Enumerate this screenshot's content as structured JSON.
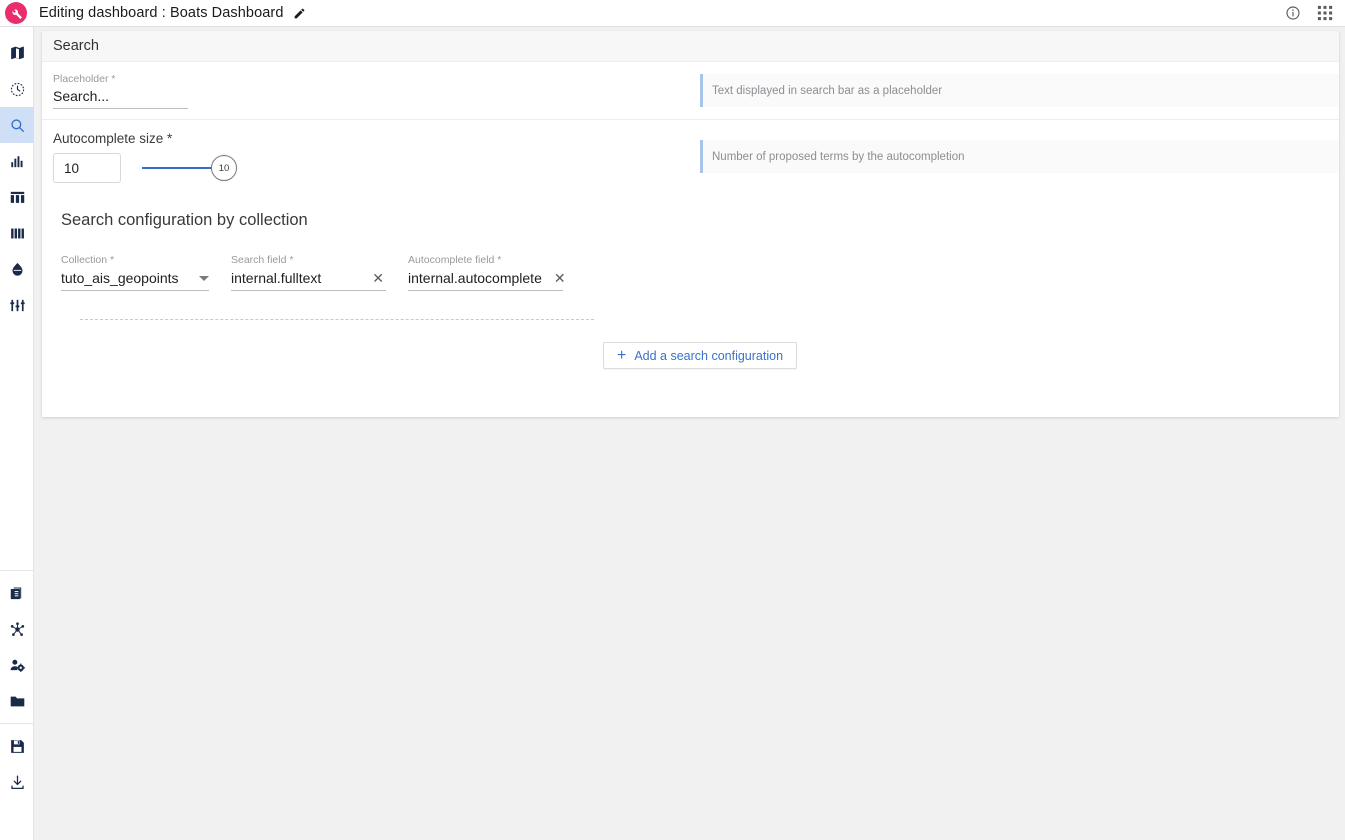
{
  "topbar": {
    "logo_icon": "wrench-icon",
    "logo_color": "#ea2d6f",
    "title": "Editing dashboard : Boats Dashboard",
    "edit_icon": "pencil-icon",
    "info_icon": "info-circle-icon",
    "apps_icon": "apps-grid-icon"
  },
  "sidebar": {
    "items": [
      {
        "name": "map",
        "icon": "map-icon",
        "active": false
      },
      {
        "name": "timeline",
        "icon": "clock-dashed-icon",
        "active": false
      },
      {
        "name": "search",
        "icon": "search-icon",
        "active": true
      },
      {
        "name": "histogram",
        "icon": "bar-chart-icon",
        "active": false
      },
      {
        "name": "table",
        "icon": "table-icon",
        "active": false
      },
      {
        "name": "columns",
        "icon": "columns-icon",
        "active": false
      },
      {
        "name": "donut",
        "icon": "drop-icon",
        "active": false
      },
      {
        "name": "filters",
        "icon": "sliders-icon",
        "active": false
      },
      {
        "name": "pages",
        "icon": "documents-icon",
        "active": false
      },
      {
        "name": "network",
        "icon": "hub-network-icon",
        "active": false
      },
      {
        "name": "user-settings",
        "icon": "user-gear-icon",
        "active": false
      },
      {
        "name": "folder",
        "icon": "folder-icon",
        "active": false
      },
      {
        "name": "save",
        "icon": "floppy-disk-icon",
        "active": false
      },
      {
        "name": "download",
        "icon": "download-icon",
        "active": false
      }
    ]
  },
  "card": {
    "header_title": "Search",
    "placeholder_field": {
      "label": "Placeholder *",
      "value": "Search...",
      "placeholder": "Search...",
      "hint": "Text displayed in search bar as a placeholder"
    },
    "autocomplete_size": {
      "label": "Autocomplete size *",
      "value": "10",
      "slider_value": "10",
      "hint": "Number of proposed terms by the autocompletion"
    },
    "config_section": {
      "title": "Search configuration by collection",
      "fields": [
        {
          "label": "Collection *",
          "value": "tuto_ais_geopoints",
          "control": "select"
        },
        {
          "label": "Search field *",
          "value": "internal.fulltext",
          "control": "clearable"
        },
        {
          "label": "Autocomplete field *",
          "value": "internal.autocomplete",
          "control": "clearable"
        }
      ],
      "clear_icon": "close-x-icon",
      "add_button": {
        "label": "Add a search configuration",
        "icon": "plus-icon"
      }
    }
  },
  "colors": {
    "brand_pink": "#ea2d6f",
    "accent_blue": "#3a72c8",
    "active_rail_bg": "#cfdff5",
    "hint_border": "#a8c4ea"
  }
}
